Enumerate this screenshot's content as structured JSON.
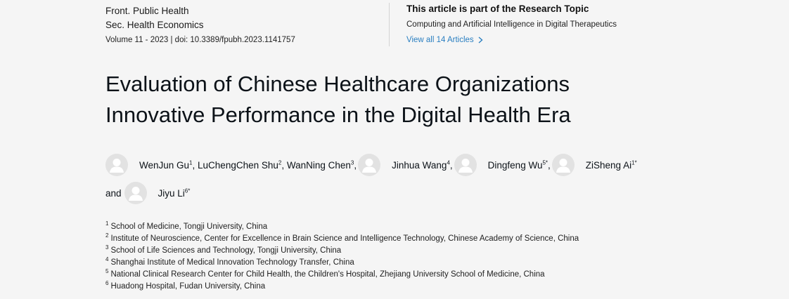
{
  "journal": {
    "name": "Front. Public Health",
    "section": "Sec. Health Economics",
    "volume": "Volume 11 - 2023 | doi: 10.3389/fpubh.2023.1141757"
  },
  "research_topic": {
    "heading": "This article is part of the Research Topic",
    "title": "Computing and Artificial Intelligence in Digital Therapeutics",
    "view_all": "View all 14 Articles"
  },
  "article": {
    "title_line1": "Evaluation of Chinese Healthcare Organizations",
    "title_line2": "Innovative Performance in the Digital Health Era"
  },
  "authors": [
    {
      "name": "WenJun Gu",
      "sup": "1"
    },
    {
      "name": "LuChengChen Shu",
      "sup": "2"
    },
    {
      "name": "WanNing Chen",
      "sup": "3"
    },
    {
      "name": "Jinhua Wang",
      "sup": "4"
    },
    {
      "name": "Dingfeng Wu",
      "sup": "5*"
    },
    {
      "name": "ZiSheng Ai",
      "sup": "1*"
    },
    {
      "name": "Jiyu Li",
      "sup": "6*"
    }
  ],
  "separators": {
    "comma": ",",
    "and": "and"
  },
  "affiliations": [
    {
      "num": "1",
      "text": "School of Medicine, Tongji University, China"
    },
    {
      "num": "2",
      "text": "Institute of Neuroscience, Center for Excellence in Brain Science and Intelligence Technology, Chinese Academy of Science, China"
    },
    {
      "num": "3",
      "text": "School of Life Sciences and Technology, Tongji University, China"
    },
    {
      "num": "4",
      "text": "Shanghai Institute of Medical Innovation Technology Transfer, China"
    },
    {
      "num": "5",
      "text": "National Clinical Research Center for Child Health, the Children's Hospital, Zhejiang University School of Medicine, China"
    },
    {
      "num": "6",
      "text": "Huadong Hospital, Fudan University, China"
    }
  ],
  "icons": {
    "avatar": "user-placeholder-icon",
    "chevron": "chevron-right-icon"
  },
  "colors": {
    "link": "#2a7fc1",
    "text": "#0c1218",
    "background": "#f5f5f5",
    "avatar": "#e2e2e2"
  }
}
